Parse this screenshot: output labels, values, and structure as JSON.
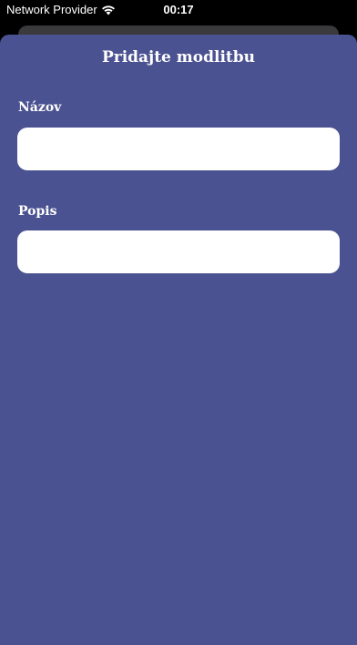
{
  "status_bar": {
    "carrier": "Network Provider",
    "time": "00:17",
    "wifi_icon": "wifi-icon"
  },
  "sheet": {
    "title": "Pridajte modlitbu",
    "background": "#4b5291"
  },
  "form": {
    "name_label": "Názov",
    "name_value": "",
    "name_placeholder": "",
    "description_label": "Popis",
    "description_value": "",
    "description_placeholder": ""
  }
}
